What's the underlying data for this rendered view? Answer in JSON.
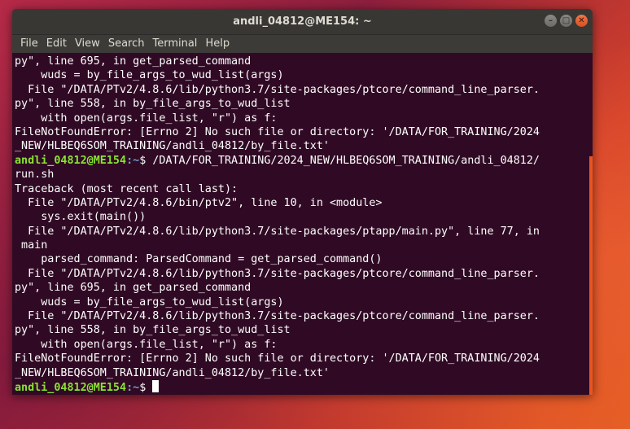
{
  "window": {
    "title": "andli_04812@ME154: ~"
  },
  "menu": [
    "File",
    "Edit",
    "View",
    "Search",
    "Terminal",
    "Help"
  ],
  "terminal": {
    "lines": [
      "py\", line 695, in get_parsed_command",
      "    wuds = by_file_args_to_wud_list(args)",
      "  File \"/DATA/PTv2/4.8.6/lib/python3.7/site-packages/ptcore/command_line_parser.",
      "py\", line 558, in by_file_args_to_wud_list",
      "    with open(args.file_list, \"r\") as f:",
      "FileNotFoundError: [Errno 2] No such file or directory: '/DATA/FOR_TRAINING/2024",
      "_NEW/HLBEQ6SOM_TRAINING/andli_04812/by_file.txt'",
      "",
      "run.sh",
      "Traceback (most recent call last):",
      "  File \"/DATA/PTv2/4.8.6/bin/ptv2\", line 10, in <module>",
      "    sys.exit(main())",
      "  File \"/DATA/PTv2/4.8.6/lib/python3.7/site-packages/ptapp/main.py\", line 77, in",
      " main",
      "    parsed_command: ParsedCommand = get_parsed_command()",
      "  File \"/DATA/PTv2/4.8.6/lib/python3.7/site-packages/ptcore/command_line_parser.",
      "py\", line 695, in get_parsed_command",
      "    wuds = by_file_args_to_wud_list(args)",
      "  File \"/DATA/PTv2/4.8.6/lib/python3.7/site-packages/ptcore/command_line_parser.",
      "py\", line 558, in by_file_args_to_wud_list",
      "    with open(args.file_list, \"r\") as f:",
      "FileNotFoundError: [Errno 2] No such file or directory: '/DATA/FOR_TRAINING/2024",
      "_NEW/HLBEQ6SOM_TRAINING/andli_04812/by_file.txt'"
    ],
    "prompt_user": "andli_04812@ME154",
    "command_line": {
      "path": ":~",
      "command": "$ /DATA/FOR_TRAINING/2024_NEW/HLBEQ6SOM_TRAINING/andli_04812/"
    },
    "final_prompt": {
      "path": ":~",
      "suffix": "$ "
    }
  },
  "colors": {
    "terminal_bg": "#300a24",
    "prompt_user": "#8ae234",
    "prompt_path": "#729fcf",
    "accent": "#e95420"
  },
  "icons": {
    "minimize": "minimize-icon",
    "maximize": "maximize-icon",
    "close": "close-icon"
  }
}
